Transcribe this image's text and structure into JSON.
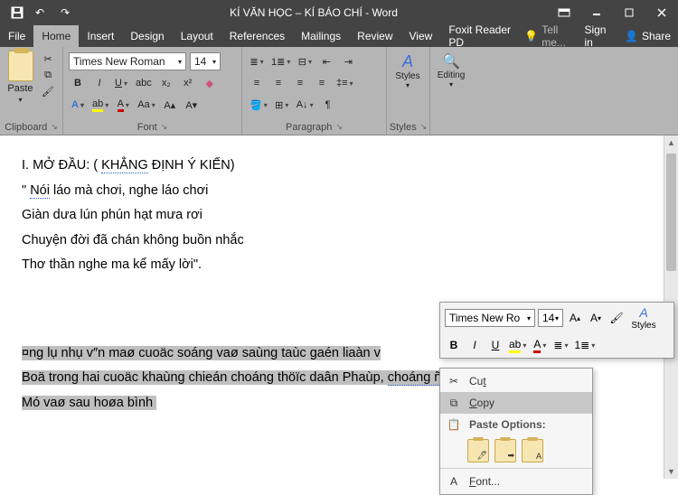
{
  "title": "KÍ VĂN HỌC – KÍ BÁO CHÍ  - Word",
  "tabs": {
    "file": "File",
    "home": "Home",
    "insert": "Insert",
    "design": "Design",
    "layout": "Layout",
    "references": "References",
    "mailings": "Mailings",
    "review": "Review",
    "view": "View",
    "foxit": "Foxit Reader PD"
  },
  "tell_me": "Tell me...",
  "signin": "Sign in",
  "share": "Share",
  "font": {
    "name": "Times New Roman",
    "size": "14"
  },
  "groups": {
    "clipboard": "Clipboard",
    "font": "Font",
    "paragraph": "Paragraph",
    "styles": "Styles",
    "editing": "Editing"
  },
  "paste": "Paste",
  "doc": {
    "l1a": "I. MỞ ĐẦU: ( ",
    "l1b": "KHẲNG",
    "l1c": " ĐỊNH Ý KIẾN)",
    "l2a": "\" ",
    "l2b": "Nói",
    "l2c": " láo mà chơi, nghe láo chơi",
    "l3": "Giàn dưa lún phún hạt mưa rơi",
    "l4": "Chuyện đời đã chán không buồn nhắc",
    "l5": "Thơ thần nghe ma kể mấy lời\".",
    "s1": "¤ng lụ nhụ v″n maø cuoäc soáng vaø saùng taùc gaén liaàn v",
    "s2": "Boä trong hai cuoäc khaùng chieán choáng thöïc daân Phaùp, ",
    "s2b": "choáng ñeá quoác",
    "s3": "Mó vaø sau hoøa bình"
  },
  "mini": {
    "fontname": "Times New Ro",
    "size": "14",
    "styles": "Styles"
  },
  "ctx": {
    "cut": "Cut",
    "copy": "Copy",
    "paste_options": "Paste Options:",
    "font": "Font..."
  }
}
